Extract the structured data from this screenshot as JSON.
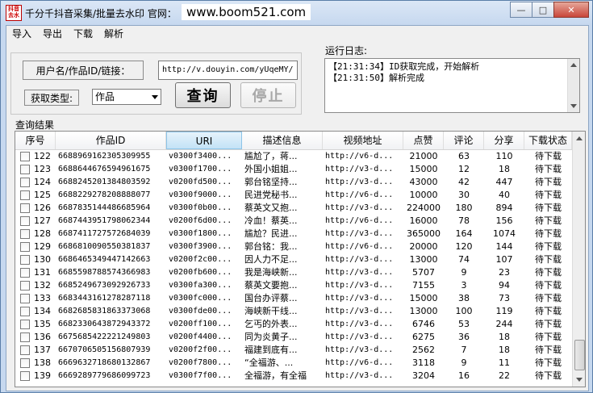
{
  "titlebar": {
    "icon_text": "抖音 去水",
    "title": "千分千抖音采集/批量去水印 官网：",
    "website": "www.boom521.com"
  },
  "menu": [
    "导入",
    "导出",
    "下载",
    "解析"
  ],
  "query": {
    "input_label": "用户名/作品ID/链接：",
    "input_value": "http://v.douyin.com/yUqeMY/",
    "type_label": "获取类型:",
    "type_value": "作品",
    "query_button": "查询",
    "stop_button": "停止"
  },
  "log": {
    "label": "运行日志:",
    "lines": [
      "【21:31:34】ID获取完成，开始解析",
      "【21:31:50】解析完成"
    ]
  },
  "results": {
    "label": "查询结果",
    "columns": [
      "序号",
      "作品ID",
      "URI",
      "描述信息",
      "视频地址",
      "点赞",
      "评论",
      "分享",
      "下载状态"
    ],
    "rows": [
      {
        "no": "122",
        "id": "6688969162305309955",
        "uri": "v0300f3400...",
        "desc": "尴尬了，蒋...",
        "video": "http://v6-d...",
        "likes": "21000",
        "comments": "63",
        "shares": "110",
        "status": "待下载"
      },
      {
        "no": "123",
        "id": "6688644676594961675",
        "uri": "v0300f1700...",
        "desc": "外国小姐姐...",
        "video": "http://v3-d...",
        "likes": "15000",
        "comments": "12",
        "shares": "18",
        "status": "待下载"
      },
      {
        "no": "124",
        "id": "6688245201384803592",
        "uri": "v0200fd500...",
        "desc": "郭台铭坚持...",
        "video": "http://v3-d...",
        "likes": "43000",
        "comments": "42",
        "shares": "447",
        "status": "待下载"
      },
      {
        "no": "125",
        "id": "6688229278208888077",
        "uri": "v0300f9000...",
        "desc": "民进党秘书...",
        "video": "http://v6-d...",
        "likes": "10000",
        "comments": "30",
        "shares": "40",
        "status": "待下载"
      },
      {
        "no": "126",
        "id": "6687835144486685964",
        "uri": "v0300f0b00...",
        "desc": "蔡英文又抱...",
        "video": "http://v3-d...",
        "likes": "224000",
        "comments": "180",
        "shares": "894",
        "status": "待下载"
      },
      {
        "no": "127",
        "id": "6687443951798062344",
        "uri": "v0200f6d00...",
        "desc": "冷血！蔡英...",
        "video": "http://v6-d...",
        "likes": "16000",
        "comments": "78",
        "shares": "156",
        "status": "待下载"
      },
      {
        "no": "128",
        "id": "6687411727572684039",
        "uri": "v0300f1800...",
        "desc": "尴尬？民进...",
        "video": "http://v3-d...",
        "likes": "365000",
        "comments": "164",
        "shares": "1074",
        "status": "待下载"
      },
      {
        "no": "129",
        "id": "6686810090550381837",
        "uri": "v0300f3900...",
        "desc": "郭台铭：我...",
        "video": "http://v6-d...",
        "likes": "20000",
        "comments": "120",
        "shares": "144",
        "status": "待下载"
      },
      {
        "no": "130",
        "id": "6686465349447142663",
        "uri": "v0200f2c00...",
        "desc": "因人力不足...",
        "video": "http://v3-d...",
        "likes": "13000",
        "comments": "74",
        "shares": "107",
        "status": "待下载"
      },
      {
        "no": "131",
        "id": "6685598788574366983",
        "uri": "v0200fb600...",
        "desc": "我是海峡新...",
        "video": "http://v3-d...",
        "likes": "5707",
        "comments": "9",
        "shares": "23",
        "status": "待下载"
      },
      {
        "no": "132",
        "id": "6685249673092926733",
        "uri": "v0300fa300...",
        "desc": "蔡英文要抱...",
        "video": "http://v3-d...",
        "likes": "7155",
        "comments": "3",
        "shares": "94",
        "status": "待下载"
      },
      {
        "no": "133",
        "id": "6683443161278287118",
        "uri": "v0300fc000...",
        "desc": "国台办评蔡...",
        "video": "http://v3-d...",
        "likes": "15000",
        "comments": "38",
        "shares": "73",
        "status": "待下载"
      },
      {
        "no": "134",
        "id": "6682685831863373068",
        "uri": "v0300fde00...",
        "desc": "海峡新干线...",
        "video": "http://v3-d...",
        "likes": "13000",
        "comments": "100",
        "shares": "119",
        "status": "待下载"
      },
      {
        "no": "135",
        "id": "6682330643872943372",
        "uri": "v0200ff100...",
        "desc": "乞丐的外表...",
        "video": "http://v3-d...",
        "likes": "6746",
        "comments": "53",
        "shares": "244",
        "status": "待下载"
      },
      {
        "no": "136",
        "id": "6675685422221249803",
        "uri": "v0200f4400...",
        "desc": "同为炎黄子...",
        "video": "http://v3-d...",
        "likes": "6275",
        "comments": "36",
        "shares": "18",
        "status": "待下载"
      },
      {
        "no": "137",
        "id": "6670706505156807939",
        "uri": "v0200f2f00...",
        "desc": "福建到底有...",
        "video": "http://v3-d...",
        "likes": "2562",
        "comments": "7",
        "shares": "18",
        "status": "待下载"
      },
      {
        "no": "138",
        "id": "6669632718680132867",
        "uri": "v0200f7800...",
        "desc": "“全福游、...",
        "video": "http://v6-d...",
        "likes": "3118",
        "comments": "9",
        "shares": "11",
        "status": "待下载"
      },
      {
        "no": "139",
        "id": "6669289779686099723",
        "uri": "v0300f7f00...",
        "desc": "全福游，有全福",
        "video": "http://v3-d...",
        "likes": "3204",
        "comments": "16",
        "shares": "22",
        "status": "待下载"
      }
    ]
  }
}
